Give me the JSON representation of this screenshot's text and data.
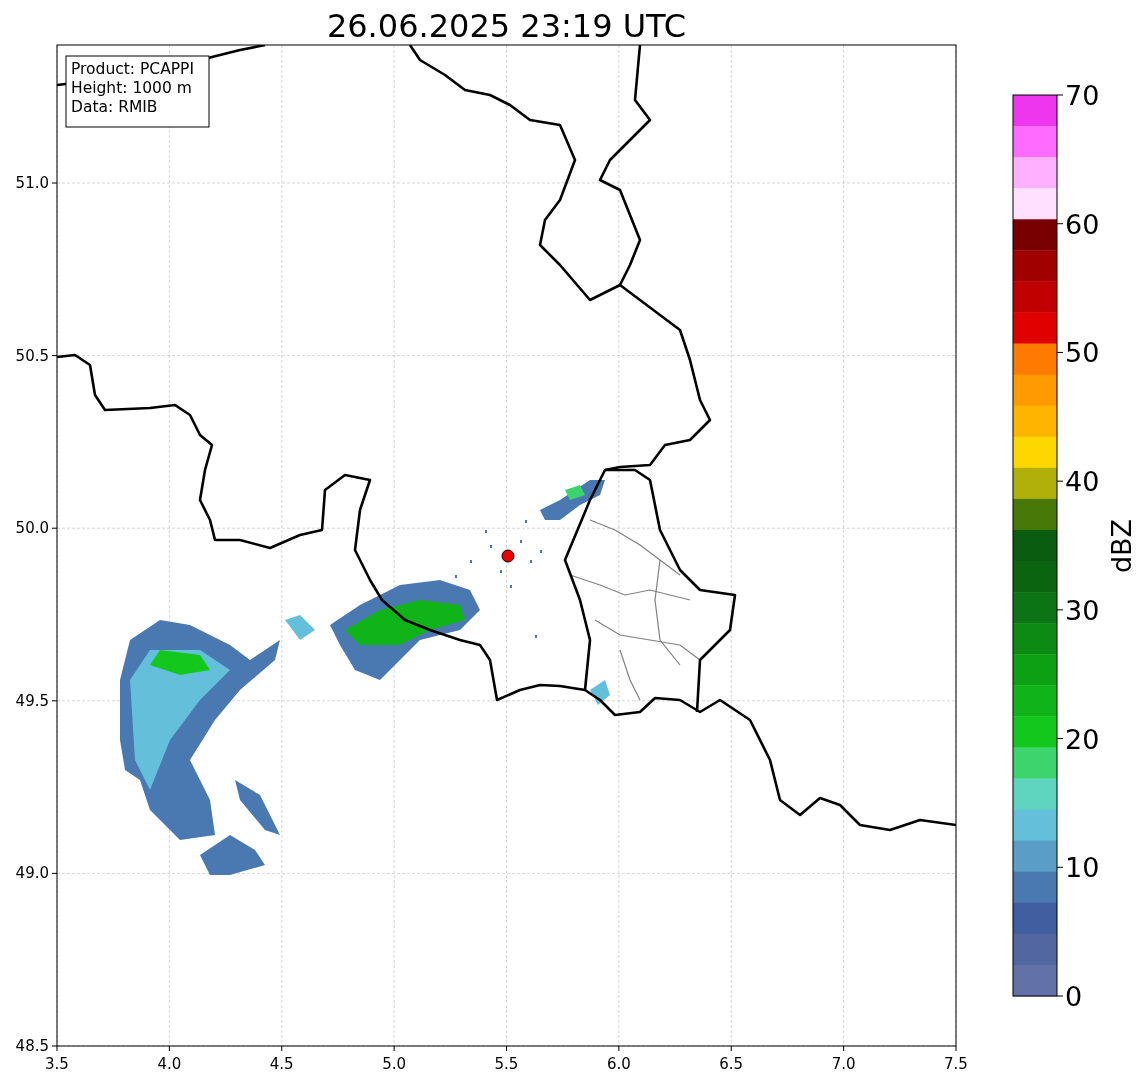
{
  "title": "26.06.2025 23:19 UTC",
  "info_box": [
    "Product: PCAPPI",
    "Height: 1000 m",
    "Data: RMIB"
  ],
  "map": {
    "yticks": [
      "51.0",
      "50.5",
      "50.0",
      "49.5",
      "49.0",
      "48.5"
    ],
    "xticks": [
      "3.5",
      "4.0",
      "4.5",
      "5.0",
      "5.5",
      "6.0",
      "6.5",
      "7.0",
      "7.5"
    ]
  },
  "colorbar": {
    "ticks": [
      "70",
      "60",
      "50",
      "40",
      "30",
      "20",
      "10",
      "0"
    ],
    "bands": [
      {
        "color": "#ee36ee"
      },
      {
        "color": "#ff6aff"
      },
      {
        "color": "#ffb0ff"
      },
      {
        "color": "#ffe0ff"
      },
      {
        "color": "#780000"
      },
      {
        "color": "#a00000"
      },
      {
        "color": "#c00000"
      },
      {
        "color": "#e00000"
      },
      {
        "color": "#ff7b00"
      },
      {
        "color": "#ff9a00"
      },
      {
        "color": "#ffb500"
      },
      {
        "color": "#ffd700"
      },
      {
        "color": "#b0b00a"
      },
      {
        "color": "#487808"
      },
      {
        "color": "#0a5c10"
      },
      {
        "color": "#0a6410"
      },
      {
        "color": "#0c7414"
      },
      {
        "color": "#0c8a14"
      },
      {
        "color": "#0ea014"
      },
      {
        "color": "#10b418"
      },
      {
        "color": "#12c81c"
      },
      {
        "color": "#3cd46c"
      },
      {
        "color": "#5fd5c0"
      },
      {
        "color": "#64c0da"
      },
      {
        "color": "#5a9dc5"
      },
      {
        "color": "#4a79b1"
      },
      {
        "color": "#415ea0"
      },
      {
        "color": "#52679f"
      },
      {
        "color": "#6272a8"
      }
    ],
    "label": "dBZ"
  }
}
